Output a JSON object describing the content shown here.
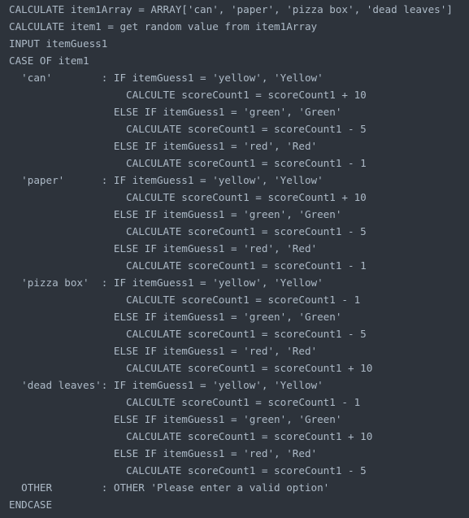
{
  "code": {
    "lines": [
      "CALCULATE item1Array = ARRAY['can', 'paper', 'pizza box', 'dead leaves']",
      "CALCULATE item1 = get random value from item1Array",
      "INPUT itemGuess1",
      "CASE OF item1",
      "  'can'        : IF itemGuess1 = 'yellow', 'Yellow'",
      "                   CALCULTE scoreCount1 = scoreCount1 + 10",
      "                 ELSE IF itemGuess1 = 'green', 'Green'",
      "                   CALCULATE scoreCount1 = scoreCount1 - 5",
      "                 ELSE IF itemGuess1 = 'red', 'Red'",
      "                   CALCULATE scoreCount1 = scoreCount1 - 1",
      "  'paper'      : IF itemGuess1 = 'yellow', 'Yellow'",
      "                   CALCULTE scoreCount1 = scoreCount1 + 10",
      "                 ELSE IF itemGuess1 = 'green', 'Green'",
      "                   CALCULATE scoreCount1 = scoreCount1 - 5",
      "                 ELSE IF itemGuess1 = 'red', 'Red'",
      "                   CALCULATE scoreCount1 = scoreCount1 - 1",
      "  'pizza box'  : IF itemGuess1 = 'yellow', 'Yellow'",
      "                   CALCULTE scoreCount1 = scoreCount1 - 1",
      "                 ELSE IF itemGuess1 = 'green', 'Green'",
      "                   CALCULATE scoreCount1 = scoreCount1 - 5",
      "                 ELSE IF itemGuess1 = 'red', 'Red'",
      "                   CALCULATE scoreCount1 = scoreCount1 + 10",
      "  'dead leaves': IF itemGuess1 = 'yellow', 'Yellow'",
      "                   CALCULTE scoreCount1 = scoreCount1 - 1",
      "                 ELSE IF itemGuess1 = 'green', 'Green'",
      "                   CALCULATE scoreCount1 = scoreCount1 + 10",
      "                 ELSE IF itemGuess1 = 'red', 'Red'",
      "                   CALCULATE scoreCount1 = scoreCount1 - 5",
      "  OTHER        : OTHER 'Please enter a valid option'",
      "ENDCASE"
    ]
  },
  "colors": {
    "background": "#2d333b",
    "text": "#adbac7"
  }
}
